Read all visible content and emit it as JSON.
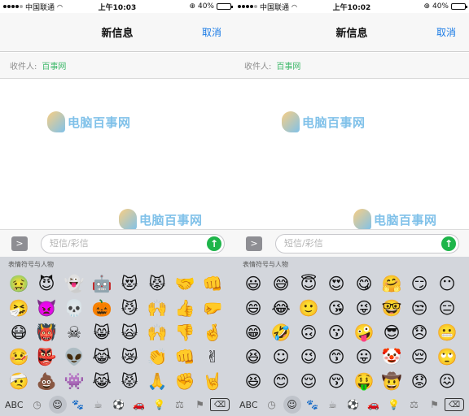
{
  "screens": [
    {
      "status": {
        "carrier": "中国联通",
        "wifi": "WiFi",
        "time": "上午10:03",
        "lock": "⊕",
        "battery": "40%",
        "battery_level": 0.4
      },
      "nav": {
        "title": "新信息",
        "cancel": "取消"
      },
      "recipient": {
        "label": "收件人:",
        "value": "百事网"
      },
      "watermark": "电脑百事网",
      "input": {
        "placeholder": "短信/彩信",
        "expand": ">",
        "send": "↑"
      },
      "keyboard": {
        "category": "表情符号与人物",
        "emojis": [
          "🤢",
          "😈",
          "👻",
          "🤖",
          "😻",
          "😾",
          "🤝",
          "👊",
          "🤧",
          "👿",
          "💀",
          "🎃",
          "😼",
          "🙌",
          "👍",
          "🤛",
          "😷",
          "👹",
          "☠",
          "😸",
          "🙀",
          "🙌",
          "👎",
          "🤞",
          "🤒",
          "👺",
          "👽",
          "😹",
          "😿",
          "👏",
          "👊",
          "✌",
          "🤕",
          "💩",
          "👾",
          "😹",
          "😾",
          "🙏",
          "✊",
          "🤘"
        ],
        "abc": "ABC",
        "categories": [
          "clock-icon",
          "smile-icon",
          "animal-icon",
          "food-icon",
          "sport-icon",
          "car-icon",
          "bulb-icon",
          "symbol-icon",
          "flag-icon"
        ],
        "category_glyphs": [
          "◷",
          "☺",
          "🐾",
          "☕",
          "⚽",
          "🚗",
          "💡",
          "⚖",
          "⚑"
        ],
        "active_category": 1,
        "delete": "⌫"
      }
    },
    {
      "status": {
        "carrier": "中国联通",
        "wifi": "WiFi",
        "time": "上午10:02",
        "lock": "⊕",
        "battery": "40%",
        "battery_level": 0.4
      },
      "nav": {
        "title": "新信息",
        "cancel": "取消"
      },
      "recipient": {
        "label": "收件人:",
        "value": "百事网"
      },
      "watermark": "电脑百事网",
      "input": {
        "placeholder": "短信/彩信",
        "expand": ">",
        "send": "↑"
      },
      "keyboard": {
        "category": "表情符号与人物",
        "emojis": [
          "😃",
          "😅",
          "😇",
          "😍",
          "😋",
          "🤗",
          "😏",
          "😶",
          "😄",
          "😂",
          "🙂",
          "😘",
          "😜",
          "🤓",
          "😒",
          "😑",
          "😁",
          "🤣",
          "🙃",
          "😗",
          "🤪",
          "😎",
          "😞",
          "😬",
          "😆",
          "☺",
          "😉",
          "😙",
          "😛",
          "🤡",
          "😔",
          "🙄",
          "😆",
          "😊",
          "😌",
          "😚",
          "🤑",
          "🤠",
          "😟",
          "😖"
        ],
        "abc": "ABC",
        "categories": [
          "clock-icon",
          "smile-icon",
          "animal-icon",
          "food-icon",
          "sport-icon",
          "car-icon",
          "bulb-icon",
          "symbol-icon",
          "flag-icon"
        ],
        "category_glyphs": [
          "◷",
          "☺",
          "🐾",
          "☕",
          "⚽",
          "🚗",
          "💡",
          "⚖",
          "⚑"
        ],
        "active_category": 1,
        "delete": "⌫"
      }
    }
  ],
  "colors": {
    "accent": "#1a7be6",
    "recipient": "#3eb86a",
    "send": "#1eb54a"
  }
}
